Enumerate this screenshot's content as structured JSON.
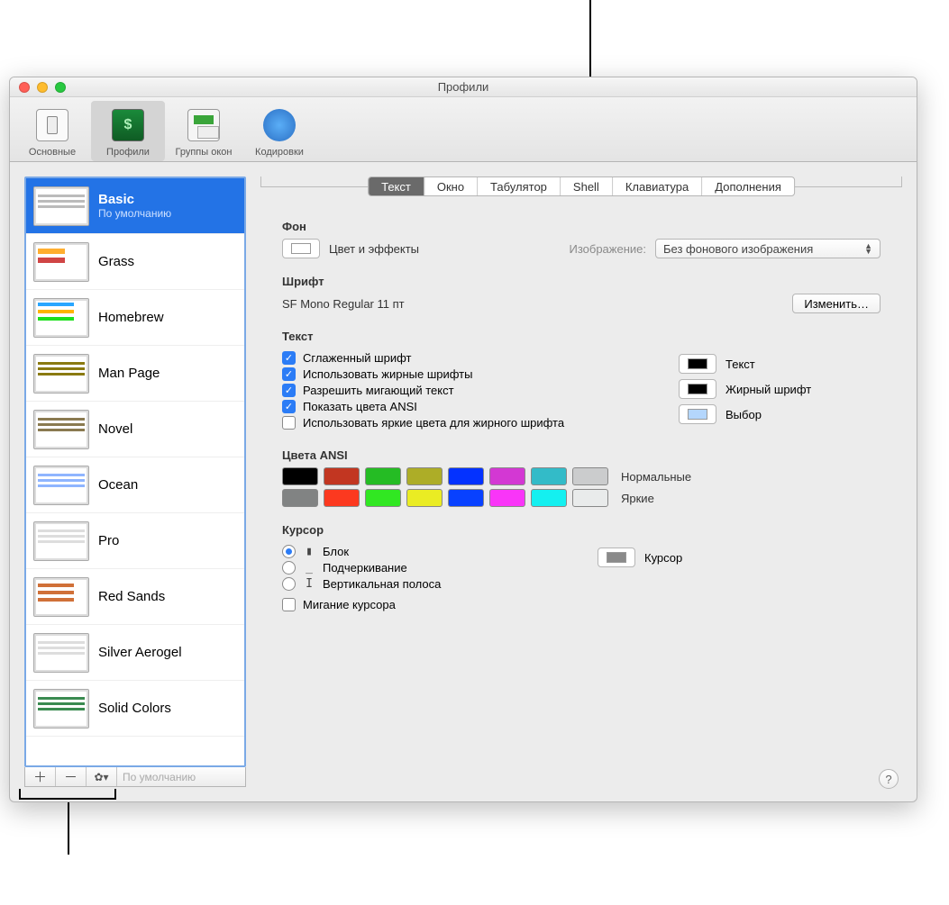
{
  "window": {
    "title": "Профили"
  },
  "toolbar": {
    "general": "Основные",
    "profiles": "Профили",
    "groups": "Группы окон",
    "encodings": "Кодировки"
  },
  "profiles": {
    "items": [
      {
        "name": "Basic",
        "sub": "По умолчанию",
        "selected": true,
        "thumb": "th-basic"
      },
      {
        "name": "Grass",
        "thumb": "th-grass"
      },
      {
        "name": "Homebrew",
        "thumb": "th-home"
      },
      {
        "name": "Man Page",
        "thumb": "th-man"
      },
      {
        "name": "Novel",
        "thumb": "th-novel"
      },
      {
        "name": "Ocean",
        "thumb": "th-ocean"
      },
      {
        "name": "Pro",
        "thumb": "th-pro"
      },
      {
        "name": "Red Sands",
        "thumb": "th-reds"
      },
      {
        "name": "Silver Aerogel",
        "thumb": "th-silver"
      },
      {
        "name": "Solid Colors",
        "thumb": "th-solid"
      }
    ],
    "default_btn": "По умолчанию"
  },
  "tabs": {
    "items": [
      "Текст",
      "Окно",
      "Табулятор",
      "Shell",
      "Клавиатура",
      "Дополнения"
    ],
    "selected": 0
  },
  "panel": {
    "bg": {
      "heading": "Фон",
      "color_effects": "Цвет и эффекты",
      "image_label": "Изображение:",
      "image_value": "Без фонового изображения"
    },
    "font": {
      "heading": "Шрифт",
      "value": "SF Mono Regular 11 пт",
      "change_btn": "Изменить…"
    },
    "text": {
      "heading": "Текст",
      "antialias": "Сглаженный шрифт",
      "bold": "Использовать жирные шрифты",
      "blink": "Разрешить мигающий текст",
      "ansi": "Показать цвета ANSI",
      "bright_bold": "Использовать яркие цвета для жирного шрифта",
      "swatch_text": "Текст",
      "swatch_bold": "Жирный шрифт",
      "swatch_sel": "Выбор"
    },
    "ansi": {
      "heading": "Цвета ANSI",
      "normal_label": "Нормальные",
      "bright_label": "Яркие",
      "normal": [
        "#000000",
        "#c23621",
        "#25bc24",
        "#adad27",
        "#0432ff",
        "#d338d3",
        "#33bbc8",
        "#cbcccd"
      ],
      "bright": [
        "#818383",
        "#fc391f",
        "#31e722",
        "#eaec23",
        "#0841ff",
        "#f935f8",
        "#14f0f0",
        "#e9ebeb"
      ]
    },
    "cursor": {
      "heading": "Курсор",
      "block": "Блок",
      "underline": "Подчеркивание",
      "vbar": "Вертикальная полоса",
      "blink": "Мигание курсора",
      "swatch_label": "Курсор"
    }
  },
  "colors": {
    "text_swatch": "#000000",
    "bold_swatch": "#000000",
    "sel_swatch": "#b4d6fc",
    "cursor_swatch": "#8a8a8a",
    "bg_swatch": "#ffffff"
  }
}
